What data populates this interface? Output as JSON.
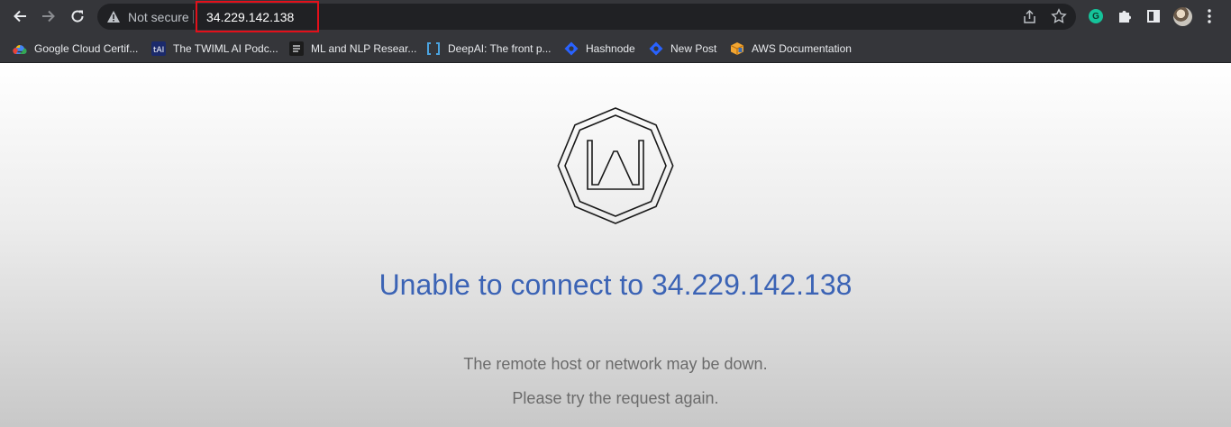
{
  "toolbar": {
    "back_icon": "back-arrow-icon",
    "forward_icon": "forward-arrow-icon",
    "reload_icon": "reload-icon",
    "security_label": "Not secure",
    "url": "34.229.142.138"
  },
  "bookmarks": [
    {
      "label": "Google Cloud Certif...",
      "icon": "google-cloud-icon"
    },
    {
      "label": "The TWIML AI Podc...",
      "icon": "twiml-icon"
    },
    {
      "label": "ML and NLP Resear...",
      "icon": "ml-nlp-icon"
    },
    {
      "label": "DeepAI: The front p...",
      "icon": "deepai-icon"
    },
    {
      "label": "Hashnode",
      "icon": "hashnode-icon"
    },
    {
      "label": "New Post",
      "icon": "hashnode-icon"
    },
    {
      "label": "AWS Documentation",
      "icon": "aws-icon"
    }
  ],
  "page": {
    "title": "Unable to connect to 34.229.142.138",
    "message_line1": "The remote host or network may be down.",
    "message_line2": "Please try the request again."
  },
  "colors": {
    "highlight_box": "#e3101a",
    "title": "#3b63b5",
    "message": "#6b6b6b",
    "toolbar": "#35363a"
  }
}
